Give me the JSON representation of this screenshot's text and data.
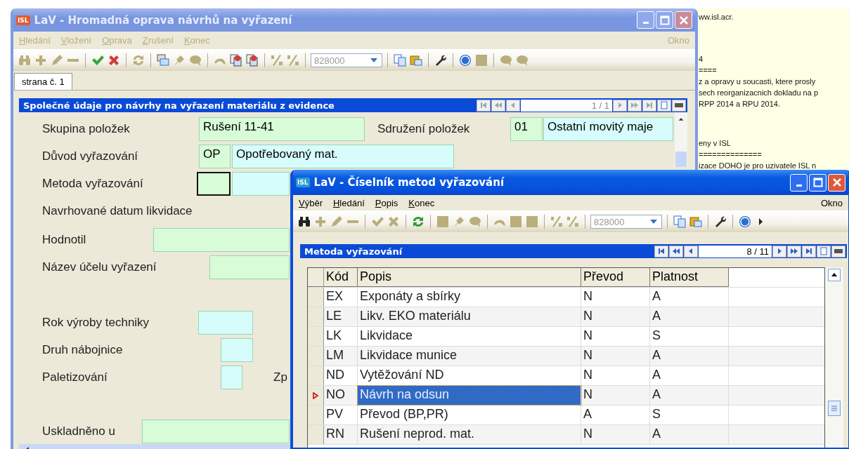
{
  "desktop_text": {
    "paragraphs": [
      [
        "ww.isl.acr."
      ],
      [
        "4",
        "====",
        "z a opravy u soucasti, ktere prosly",
        "sech reorganizacnich dokladu na p",
        "RPP 2014 a RPU 2014."
      ],
      [
        "eny v ISL",
        "==============",
        "izace DOHO je pro uzivatele ISL n"
      ]
    ]
  },
  "main_window": {
    "logo": "ISL",
    "title": "LaV - Hromadná oprava návrhů na vyřazení",
    "active": false,
    "menu": [
      {
        "label": "Hledání",
        "disabled": true
      },
      {
        "label": "Vložení",
        "disabled": true
      },
      {
        "label": "Oprava",
        "disabled": true
      },
      {
        "label": "Zrušení",
        "disabled": true
      },
      {
        "label": "Konec",
        "disabled": true
      }
    ],
    "menu_right": {
      "label": "Okno",
      "disabled": true
    },
    "combo": "828000",
    "tabs": [
      {
        "label": "strana č. 1",
        "selected": true
      }
    ],
    "panel": {
      "title": "Společné údaje pro návrhy na vyřazení materiálu z evidence",
      "record": "1 / 1"
    },
    "form": [
      {
        "label": "Skupina položek",
        "boxes": [
          {
            "value": "Rušení 11-41",
            "color": "#d8fcd8",
            "focused": false
          }
        ],
        "label_2": "Sdružení položek",
        "boxes_2": [
          {
            "value": "01",
            "color": "#d8fcd8",
            "focused": false
          },
          {
            "value": "Ostatní movitý maje",
            "color": "#d6fcfc",
            "focused": false
          }
        ]
      },
      {
        "label": "Důvod vyřazování",
        "boxes": [
          {
            "value": "OP",
            "color": "#d8fcd8",
            "focused": false
          },
          {
            "value": "Opotřebovaný mat.",
            "color": "#d6fcfc",
            "focused": false
          }
        ]
      },
      {
        "label": "Metoda vyřazování",
        "boxes": [
          {
            "color": "#d8fcd8",
            "focused": true
          },
          {
            "color": "#d6fcfc",
            "focused": false
          }
        ]
      },
      {
        "label": "Navrhované datum likvidace"
      },
      {
        "label": "Hodnotil",
        "boxes": [
          {
            "color": "#d8fcd8",
            "focused": false
          }
        ]
      },
      {
        "label": "Název účelu vyřazení",
        "boxes": [
          {
            "color": "#d8fcd8",
            "focused": false
          }
        ]
      },
      {
        "label": "Rok výroby techniky",
        "boxes": [
          {
            "color": "#d6fcfc",
            "focused": false
          }
        ]
      },
      {
        "label": "Druh nábojnice",
        "boxes": [
          {
            "color": "#d6fcfc",
            "focused": false
          }
        ]
      },
      {
        "label": "Paletizování",
        "boxes": [
          {
            "color": "#d6fcfc",
            "focused": false
          }
        ],
        "label_2": "Zp"
      },
      {
        "label": "Uskladněno u",
        "boxes": [
          {
            "color": "#d8fcd8",
            "focused": false
          }
        ]
      }
    ]
  },
  "lookup_window": {
    "logo": "ISL",
    "title": "LaV - Číselník metod vyřazování",
    "active": true,
    "menu": [
      {
        "label": "Výběr",
        "disabled": false
      },
      {
        "label": "Hledání",
        "disabled": false
      },
      {
        "label": "Popis",
        "disabled": false
      },
      {
        "label": "Konec",
        "disabled": false
      }
    ],
    "menu_right": {
      "label": "Okno",
      "disabled": false
    },
    "combo": "828000",
    "panel": {
      "title": "Metoda vyřazování",
      "record": "8 / 11"
    },
    "table": {
      "columns": [
        "Kód",
        "Popis",
        "Převod",
        "Platnost"
      ],
      "rows": [
        {
          "cells": [
            "EX",
            "Exponáty a sbírky",
            "N",
            "A"
          ],
          "selected": false
        },
        {
          "cells": [
            "LE",
            "Likv. EKO materiálu",
            "N",
            "A"
          ],
          "selected": false
        },
        {
          "cells": [
            "LK",
            "Likvidace",
            "N",
            "S"
          ],
          "selected": false
        },
        {
          "cells": [
            "LM",
            "Likvidace munice",
            "N",
            "A"
          ],
          "selected": false
        },
        {
          "cells": [
            "ND",
            "Vytěžování ND",
            "N",
            "A"
          ],
          "selected": false
        },
        {
          "cells": [
            "NO",
            "Návrh na odsun",
            "N",
            "A"
          ],
          "selected": true
        },
        {
          "cells": [
            "PV",
            "Převod (BP,PR)",
            "A",
            "S"
          ],
          "selected": false
        },
        {
          "cells": [
            "RN",
            "Rušení neprod. mat.",
            "N",
            "A"
          ],
          "selected": false
        }
      ]
    }
  }
}
